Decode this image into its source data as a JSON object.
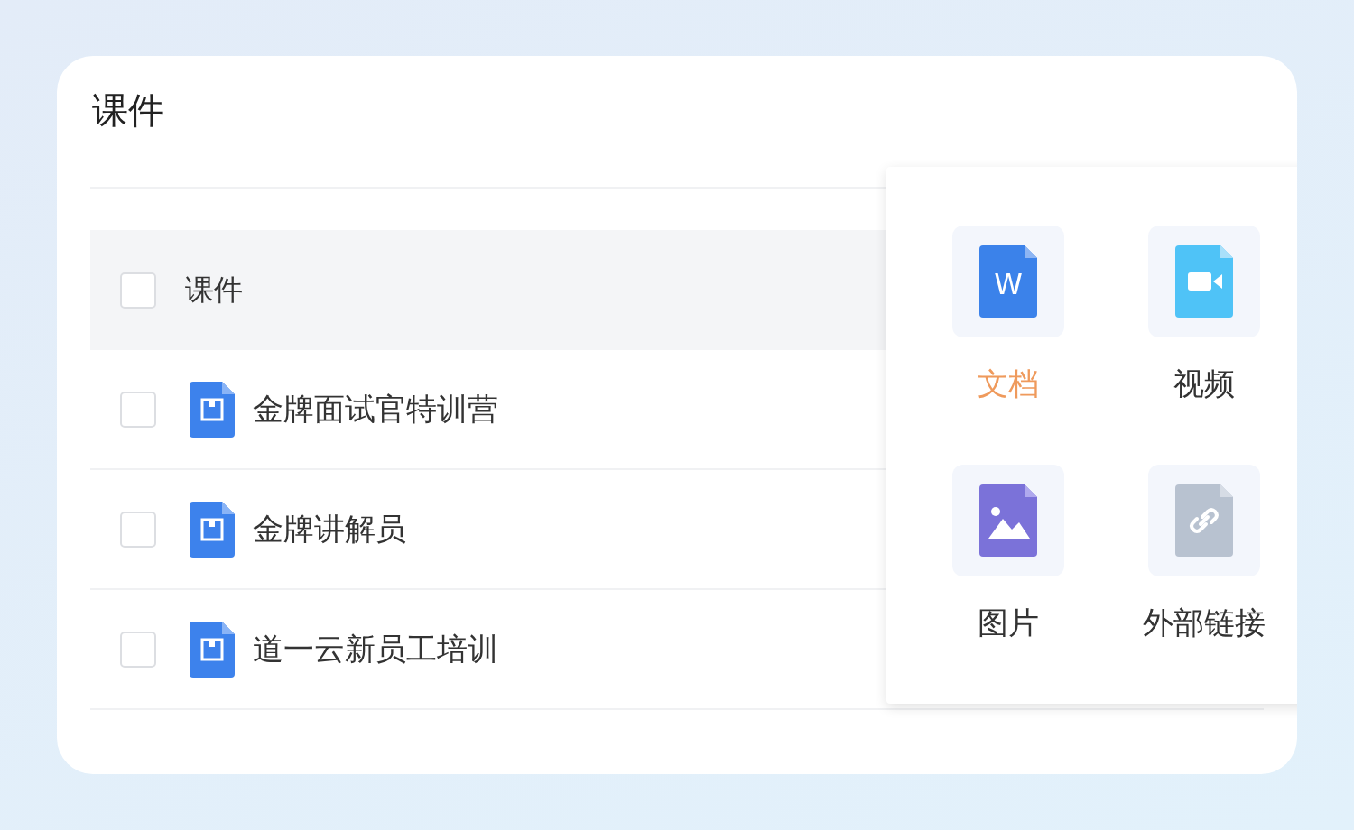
{
  "title": "课件",
  "table": {
    "rows": [
      {
        "kind": "header",
        "label": "课件",
        "checked": false
      },
      {
        "kind": "file",
        "label": "金牌面试官特训营",
        "checked": false
      },
      {
        "kind": "file",
        "label": "金牌讲解员",
        "checked": false
      },
      {
        "kind": "file",
        "label": "道一云新员工培训",
        "checked": false
      }
    ]
  },
  "type_menu": {
    "items": [
      {
        "kind": "document",
        "label": "文档",
        "icon_letter": "W",
        "selected": true
      },
      {
        "kind": "video",
        "label": "视频",
        "selected": false
      },
      {
        "kind": "image",
        "label": "图片",
        "selected": false
      },
      {
        "kind": "link",
        "label": "外部链接",
        "selected": false
      }
    ]
  }
}
